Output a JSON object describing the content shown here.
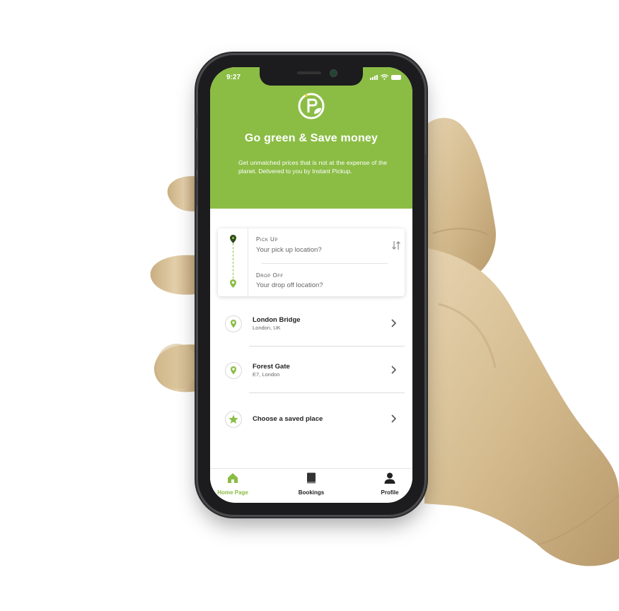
{
  "status_bar": {
    "time": "9:27"
  },
  "hero": {
    "title": "Go green & Save money",
    "description": "Get unmatched prices that is not at the expense of the planet. Delivered to you by Instant Pickup."
  },
  "route": {
    "pickup_label": "Pick Up",
    "pickup_placeholder": "Your pick up location?",
    "dropoff_label": "Drop Off",
    "dropoff_placeholder": "Your drop off location?"
  },
  "places": [
    {
      "title": "London Bridge",
      "subtitle": "London, UK",
      "icon": "location-pin-icon"
    },
    {
      "title": "Forest Gate",
      "subtitle": "E7, London",
      "icon": "location-pin-icon"
    },
    {
      "title": "Choose a saved place",
      "subtitle": "",
      "icon": "star-icon"
    }
  ],
  "tabs": [
    {
      "label": "Home Page",
      "icon": "home-icon",
      "active": true
    },
    {
      "label": "Bookings",
      "icon": "book-icon",
      "active": false
    },
    {
      "label": "Profile",
      "icon": "user-icon",
      "active": false
    }
  ],
  "colors": {
    "accent": "#8bbd45",
    "text_dark": "#222222",
    "inactive_tab": "#222222"
  }
}
